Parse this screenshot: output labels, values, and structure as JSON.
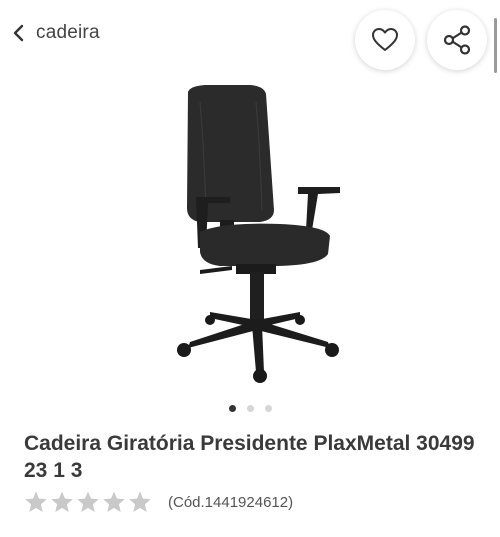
{
  "header": {
    "back_label": "cadeira",
    "actions": [
      {
        "name": "favorite",
        "icon": "heart-icon"
      },
      {
        "name": "share",
        "icon": "share-icon"
      }
    ]
  },
  "product": {
    "image_icon": "office-chair-image",
    "carousel": {
      "total": 3,
      "active": 1
    },
    "title": "Cadeira Giratória Presidente PlaxMetal 30499 23 1 3",
    "rating": {
      "value": 0,
      "max": 5
    },
    "code": "(Cód.1441924612)"
  },
  "colors": {
    "text": "#3a3a3a",
    "star_empty": "#c9c9c9",
    "dot_active": "#333333",
    "dot_inactive": "#d6d6d6"
  }
}
